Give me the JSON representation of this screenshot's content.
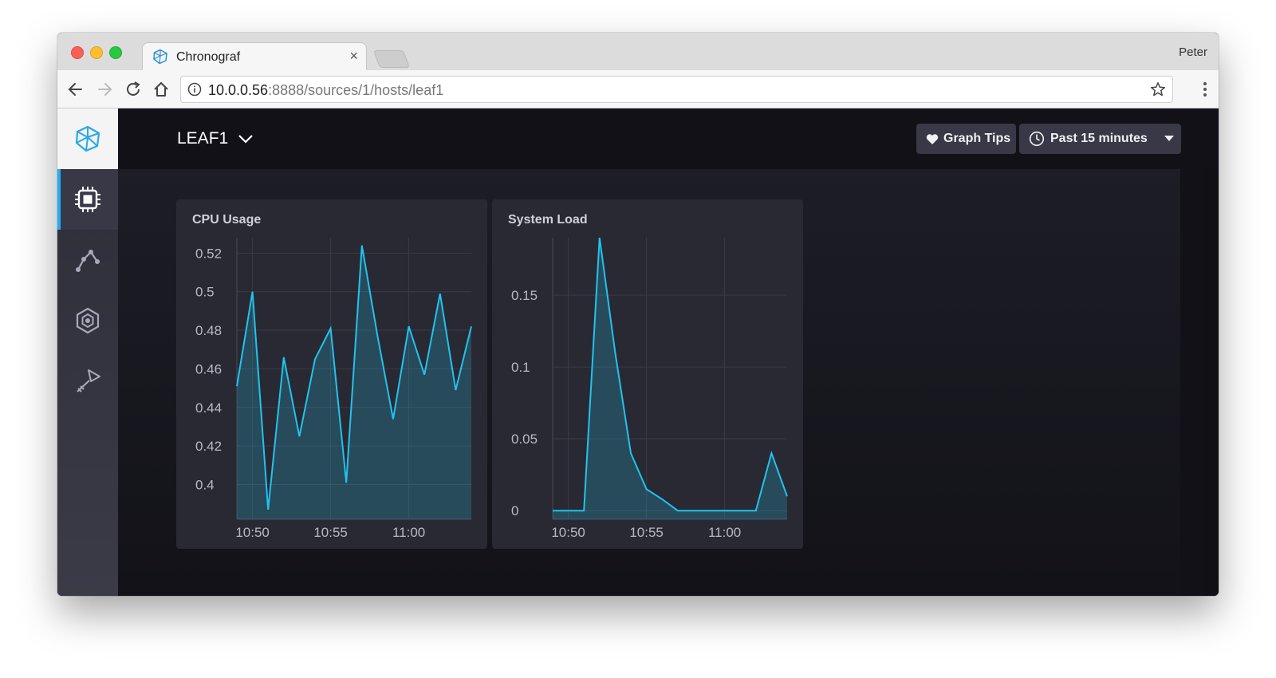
{
  "browser": {
    "tab_title": "Chronograf",
    "tab_close": "×",
    "profile_name": "Peter",
    "url_host": "10.0.0.56",
    "url_rest": ":8888/sources/1/hosts/leaf1"
  },
  "sidebar": {
    "items": [
      {
        "icon": "cpu-icon",
        "active": true
      },
      {
        "icon": "graph-icon",
        "active": false
      },
      {
        "icon": "hexagon-alert-icon",
        "active": false
      },
      {
        "icon": "wrench-key-icon",
        "active": false
      }
    ],
    "accent_color": "#22adf6"
  },
  "header": {
    "host": "LEAF1",
    "graph_tips_label": "Graph Tips",
    "time_range_label": "Past 15 minutes"
  },
  "colors": {
    "line": "#22c3ee",
    "panel": "#292933",
    "app_bg": "#111117"
  },
  "chart_data": [
    {
      "type": "area",
      "title": "CPU Usage",
      "x_ticks": [
        "10:50",
        "10:55",
        "11:00"
      ],
      "x_tick_minutes": [
        0,
        5,
        10
      ],
      "xlim": [
        -1,
        14
      ],
      "ylim": [
        0.382,
        0.528
      ],
      "y_ticks": [
        0.4,
        0.42,
        0.44,
        0.46,
        0.48,
        0.5,
        0.52
      ],
      "y_tick_labels": [
        "0.4",
        "0.42",
        "0.44",
        "0.46",
        "0.48",
        "0.5",
        "0.52"
      ],
      "grid": true,
      "series": [
        {
          "x": [
            -1,
            0,
            1,
            2,
            3,
            4,
            5,
            6,
            7,
            8,
            9,
            10,
            11,
            12,
            13,
            14
          ],
          "values": [
            0.451,
            0.5,
            0.387,
            0.466,
            0.425,
            0.465,
            0.481,
            0.401,
            0.524,
            0.477,
            0.434,
            0.482,
            0.457,
            0.499,
            0.449,
            0.482
          ]
        }
      ]
    },
    {
      "type": "area",
      "title": "System Load",
      "x_ticks": [
        "10:50",
        "10:55",
        "11:00"
      ],
      "x_tick_minutes": [
        0,
        5,
        10
      ],
      "xlim": [
        -1,
        14
      ],
      "ylim": [
        -0.006,
        0.19
      ],
      "y_ticks": [
        0,
        0.05,
        0.1,
        0.15
      ],
      "y_tick_labels": [
        "0",
        "0.05",
        "0.1",
        "0.15"
      ],
      "grid": true,
      "series": [
        {
          "x": [
            -1,
            0,
            1,
            2,
            3,
            4,
            5,
            6,
            7,
            8,
            9,
            10,
            11,
            12,
            13,
            14
          ],
          "values": [
            0,
            0,
            0,
            0.19,
            0.11,
            0.04,
            0.015,
            0.008,
            0,
            0,
            0,
            0,
            0,
            0,
            0.04,
            0.01
          ]
        }
      ]
    }
  ]
}
